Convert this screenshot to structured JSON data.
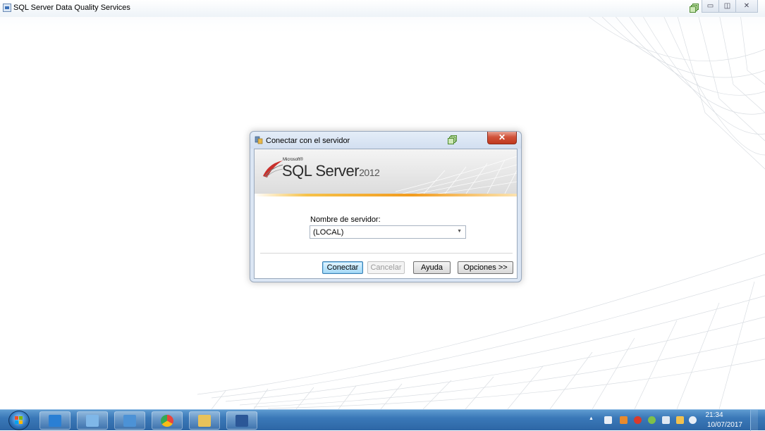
{
  "app": {
    "title": "SQL Server Data Quality Services",
    "controls": {
      "minimize": "▭",
      "maximize": "◫",
      "close": "✕"
    }
  },
  "dialog": {
    "title": "Conectar con el servidor",
    "close_label": "✕",
    "banner": {
      "brand_small": "Microsoft®",
      "product": "SQL Server",
      "version": "2012"
    },
    "server_label": "Nombre de servidor:",
    "server_value": "(LOCAL)",
    "buttons": {
      "connect": "Conectar",
      "cancel": "Cancelar",
      "help": "Ayuda",
      "options": "Opciones >>"
    }
  },
  "taskbar": {
    "pinned": [
      {
        "icon": "internet-explorer-icon",
        "color": "#2a7fd4"
      },
      {
        "icon": "network-icon",
        "color": "#7fb7e8"
      },
      {
        "icon": "image-viewer-icon",
        "color": "#4c92d6"
      },
      {
        "icon": "chrome-icon",
        "color": "#e8453c"
      },
      {
        "icon": "file-explorer-icon",
        "color": "#e8c25a"
      },
      {
        "icon": "word-icon",
        "color": "#2b5797"
      }
    ],
    "tray": {
      "up_arrow": "▲"
    },
    "clock": {
      "time": "21:34",
      "date": "10/07/2017"
    }
  }
}
